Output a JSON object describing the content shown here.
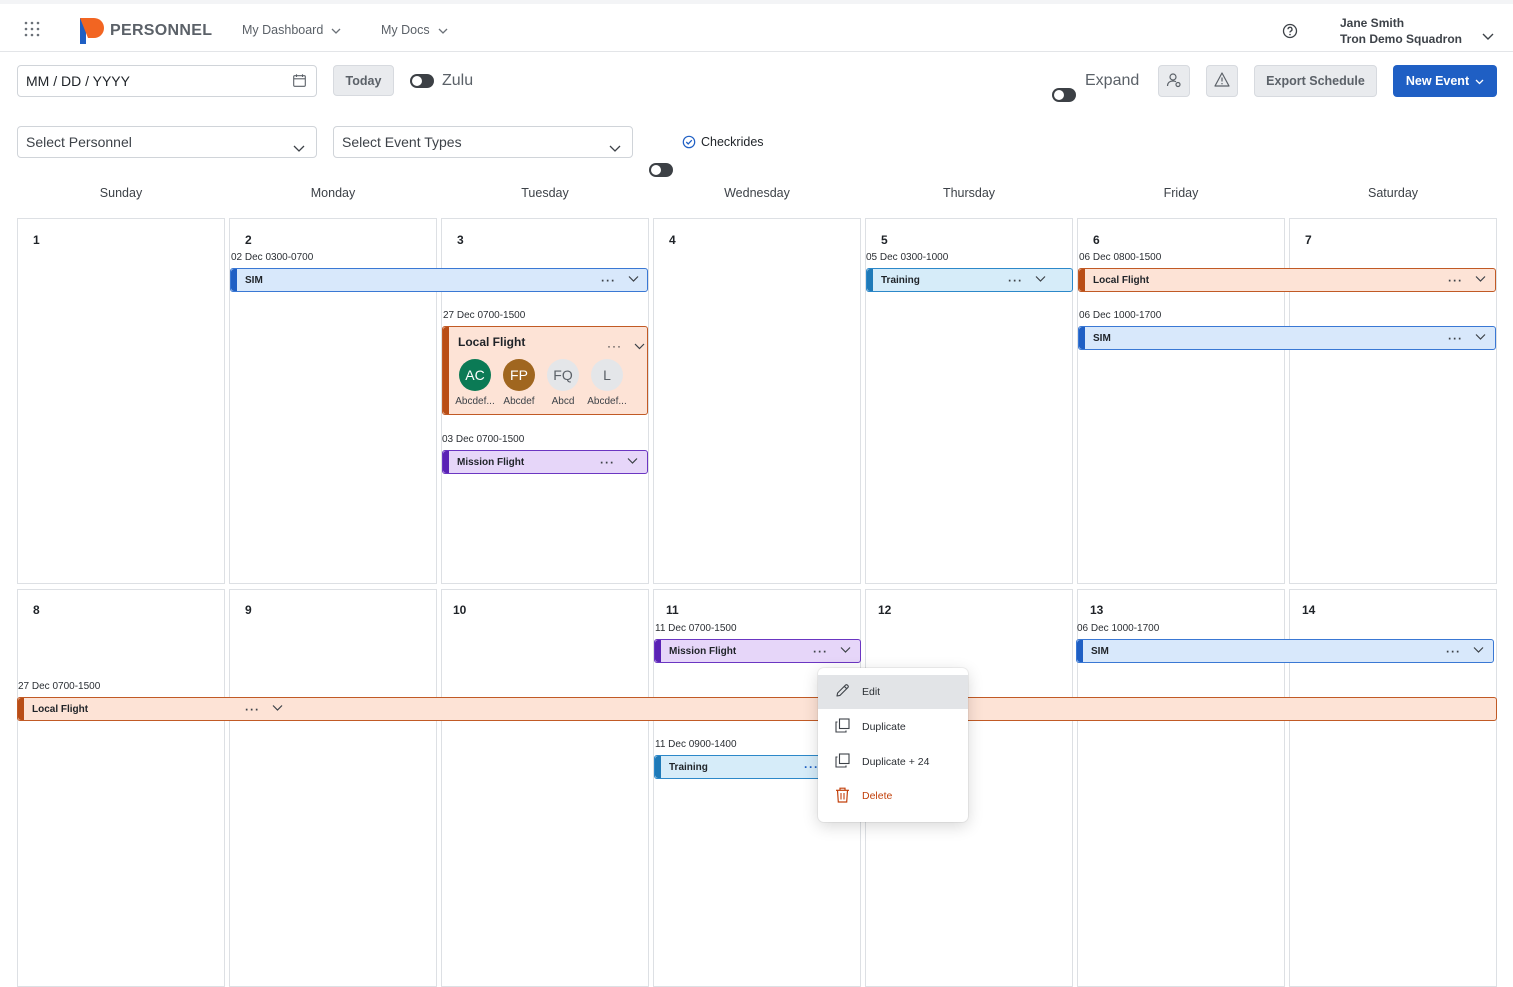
{
  "header": {
    "brand": "PERSONNEL",
    "nav": [
      {
        "label": "My Dashboard"
      },
      {
        "label": "My Docs"
      }
    ],
    "user": {
      "name": "Jane Smith",
      "unit": "Tron Demo Squadron"
    },
    "icons": {
      "apps": "grid-icon",
      "help": "help-circle-icon",
      "caret": "chevron-down-icon"
    }
  },
  "toolbar": {
    "date_placeholder": "MM / DD / YYYY",
    "today_label": "Today",
    "zulu_label": "Zulu",
    "expand_label": "Expand",
    "export_label": "Export Schedule",
    "new_event_label": "New Event"
  },
  "filters": {
    "personnel_placeholder": "Select Personnel",
    "event_types_placeholder": "Select Event Types",
    "checkrides_label": "Checkrides"
  },
  "calendar": {
    "weekdays": [
      "Sunday",
      "Monday",
      "Tuesday",
      "Wednesday",
      "Thursday",
      "Friday",
      "Saturday"
    ],
    "week1_days": [
      "1",
      "2",
      "3",
      "4",
      "5",
      "6",
      "7"
    ],
    "week2_days": [
      "8",
      "9",
      "10",
      "11",
      "12",
      "13",
      "14"
    ],
    "events": {
      "sim_mon": {
        "time": "02 Dec 0300-0700",
        "title": "SIM"
      },
      "local_tue": {
        "time": "27 Dec 0700-1500",
        "title": "Local Flight",
        "attendees": [
          {
            "initials": "AC",
            "name": "Abcdef...",
            "color": "#0b7a55"
          },
          {
            "initials": "FP",
            "name": "Abcdef",
            "color": "#a0661f"
          },
          {
            "initials": "FQ",
            "name": "Abcd",
            "color": "#e4e6e9"
          },
          {
            "initials": "L",
            "name": "Abcdef...",
            "color": "#e4e6e9"
          }
        ]
      },
      "mission_tue": {
        "time": "03 Dec 0700-1500",
        "title": "Mission Flight"
      },
      "training_thu": {
        "time": "05 Dec 0300-1000",
        "title": "Training"
      },
      "local_fri": {
        "time": "06 Dec 0800-1500",
        "title": "Local Flight"
      },
      "sim_fri": {
        "time": "06 Dec 1000-1700",
        "title": "SIM"
      },
      "mission_wed2": {
        "time": "11 Dec 0700-1500",
        "title": "Mission Flight"
      },
      "sim_fri2": {
        "time": "06 Dec 1000-1700",
        "title": "SIM"
      },
      "local_week2": {
        "time": "27 Dec 0700-1500",
        "title": "Local Flight"
      },
      "training_wed2": {
        "time": "11 Dec 0900-1400",
        "title": "Training"
      }
    }
  },
  "context_menu": {
    "items": [
      {
        "label": "Edit",
        "icon": "pencil-icon"
      },
      {
        "label": "Duplicate",
        "icon": "duplicate-icon"
      },
      {
        "label": "Duplicate + 24",
        "icon": "duplicate-icon"
      },
      {
        "label": "Delete",
        "icon": "trash-icon"
      }
    ]
  },
  "colors": {
    "primary": "#1f5fc4",
    "sim": "#1f5fc4",
    "local_flight": "#b94d16",
    "mission_flight": "#5a22b5",
    "training": "#1f7ab8",
    "delete": "#c2410c"
  }
}
